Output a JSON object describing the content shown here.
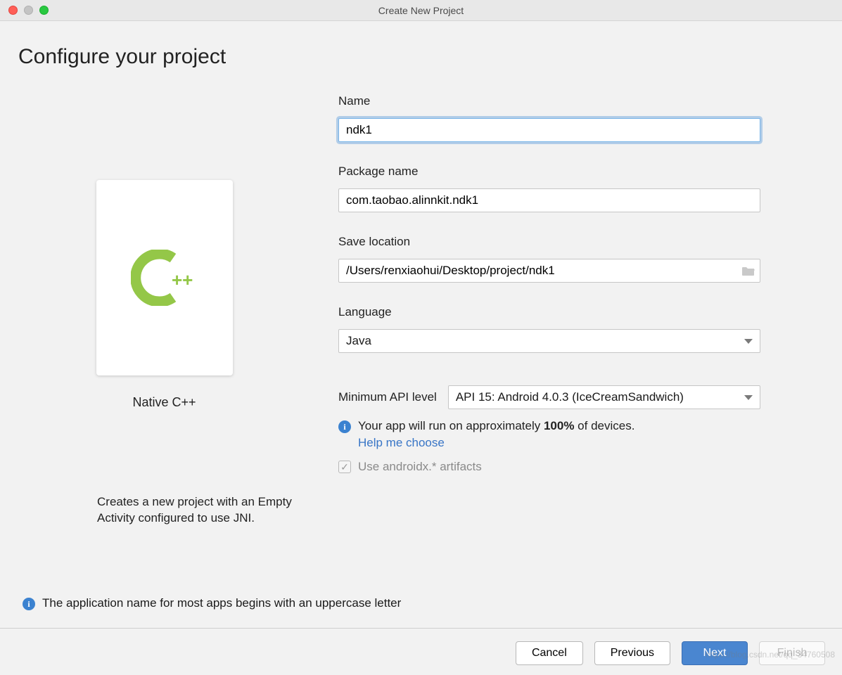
{
  "window": {
    "title": "Create New Project"
  },
  "header": {
    "title": "Configure your project"
  },
  "template": {
    "name": "Native C++",
    "description": "Creates a new project with an Empty Activity configured to use JNI."
  },
  "form": {
    "name": {
      "label": "Name",
      "value": "ndk1"
    },
    "package": {
      "label": "Package name",
      "value": "com.taobao.alinnkit.ndk1"
    },
    "location": {
      "label": "Save location",
      "value": "/Users/renxiaohui/Desktop/project/ndk1"
    },
    "language": {
      "label": "Language",
      "value": "Java"
    },
    "api": {
      "label": "Minimum API level",
      "value": "API 15: Android 4.0.3 (IceCreamSandwich)"
    },
    "compat_prefix": "Your app will run on approximately ",
    "compat_pct": "100%",
    "compat_suffix": " of devices.",
    "help_link": "Help me choose",
    "androidx_label": "Use androidx.* artifacts"
  },
  "footer_info": "The application name for most apps begins with an uppercase letter",
  "buttons": {
    "cancel": "Cancel",
    "previous": "Previous",
    "next": "Next",
    "finish": "Finish"
  },
  "watermark": "https://blog.csdn.net/qq_34760508"
}
